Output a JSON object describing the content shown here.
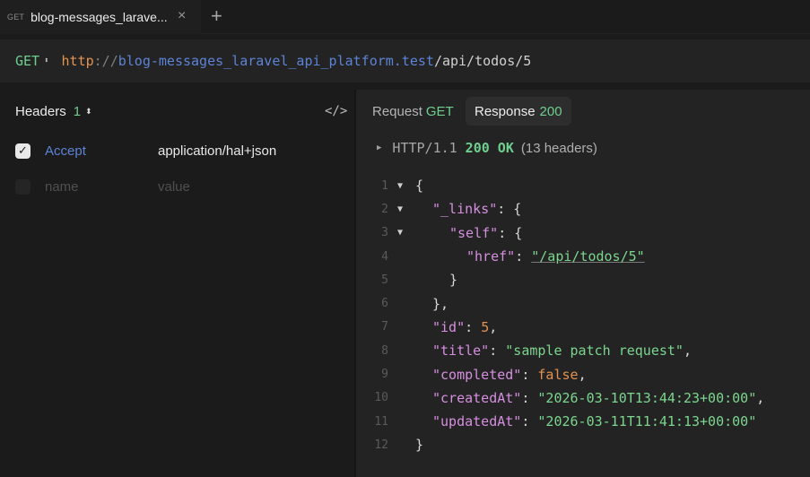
{
  "tab": {
    "method": "GET",
    "title": "blog-messages_larave...",
    "close_glyph": "×",
    "add_glyph": "+"
  },
  "request": {
    "method": "GET",
    "method_arrows": "⬍",
    "url_scheme": "http",
    "url_sep": "://",
    "url_host": "blog-messages_laravel_api_platform.test",
    "url_path": "/api/todos/5"
  },
  "headers_panel": {
    "title": "Headers",
    "count": "1",
    "count_arrows": "⬍",
    "code_toggle_glyph": "</>",
    "rows": [
      {
        "checked": true,
        "name": "Accept",
        "value": "application/hal+json"
      },
      {
        "checked": false,
        "name": "name",
        "value": "value"
      }
    ]
  },
  "response_panel": {
    "request_tab_label": "Request",
    "request_tab_method": "GET",
    "response_tab_label": "Response",
    "response_tab_status": "200",
    "status_line": {
      "protocol": "HTTP/1.1",
      "code": "200 OK",
      "headers_count": "(13 headers)"
    },
    "lines": [
      {
        "n": "1",
        "fold": true,
        "indent": 0,
        "text": "{"
      },
      {
        "n": "2",
        "fold": true,
        "indent": 1,
        "key": "\"_links\"",
        "text": ": {"
      },
      {
        "n": "3",
        "fold": true,
        "indent": 2,
        "key": "\"self\"",
        "text": ": {"
      },
      {
        "n": "4",
        "fold": false,
        "indent": 3,
        "key": "\"href\"",
        "sep": ": ",
        "link": "\"/api/todos/5\""
      },
      {
        "n": "5",
        "fold": false,
        "indent": 2,
        "text": "}"
      },
      {
        "n": "6",
        "fold": false,
        "indent": 1,
        "text": "},"
      },
      {
        "n": "7",
        "fold": false,
        "indent": 1,
        "key": "\"id\"",
        "sep": ": ",
        "num": "5",
        "tail": ","
      },
      {
        "n": "8",
        "fold": false,
        "indent": 1,
        "key": "\"title\"",
        "sep": ": ",
        "str": "\"sample patch request\"",
        "tail": ","
      },
      {
        "n": "9",
        "fold": false,
        "indent": 1,
        "key": "\"completed\"",
        "sep": ": ",
        "bool": "false",
        "tail": ","
      },
      {
        "n": "10",
        "fold": false,
        "indent": 1,
        "key": "\"createdAt\"",
        "sep": ": ",
        "str": "\"2026-03-10T13:44:23+00:00\"",
        "tail": ","
      },
      {
        "n": "11",
        "fold": false,
        "indent": 1,
        "key": "\"updatedAt\"",
        "sep": ": ",
        "str": "\"2026-03-11T11:41:13+00:00\"",
        "tail": ""
      },
      {
        "n": "12",
        "fold": false,
        "indent": 0,
        "text": "}"
      }
    ]
  },
  "colors": {
    "accent_green": "#6fcf8f",
    "scheme_orange": "#e3924f",
    "host_blue": "#5d83d6",
    "json_key": "#d68fe0",
    "json_string": "#7cd68f"
  }
}
